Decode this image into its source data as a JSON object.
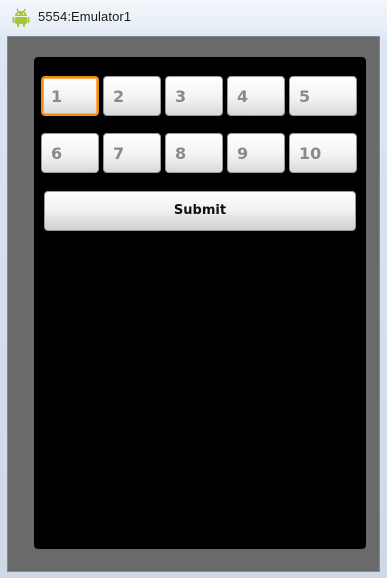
{
  "window": {
    "title": "5554:Emulator1",
    "icon": "android-icon"
  },
  "form": {
    "fields": [
      {
        "label": "1",
        "focused": true
      },
      {
        "label": "2",
        "focused": false
      },
      {
        "label": "3",
        "focused": false
      },
      {
        "label": "4",
        "focused": false
      },
      {
        "label": "5",
        "focused": false
      },
      {
        "label": "6",
        "focused": false
      },
      {
        "label": "7",
        "focused": false
      },
      {
        "label": "8",
        "focused": false
      },
      {
        "label": "9",
        "focused": false
      },
      {
        "label": "10",
        "focused": false
      }
    ],
    "submit_label": "Submit"
  },
  "colors": {
    "focus_border": "#f08a16",
    "screen_background": "#000000",
    "frame": "#6a6a6a",
    "android_green": "#a4c639"
  }
}
